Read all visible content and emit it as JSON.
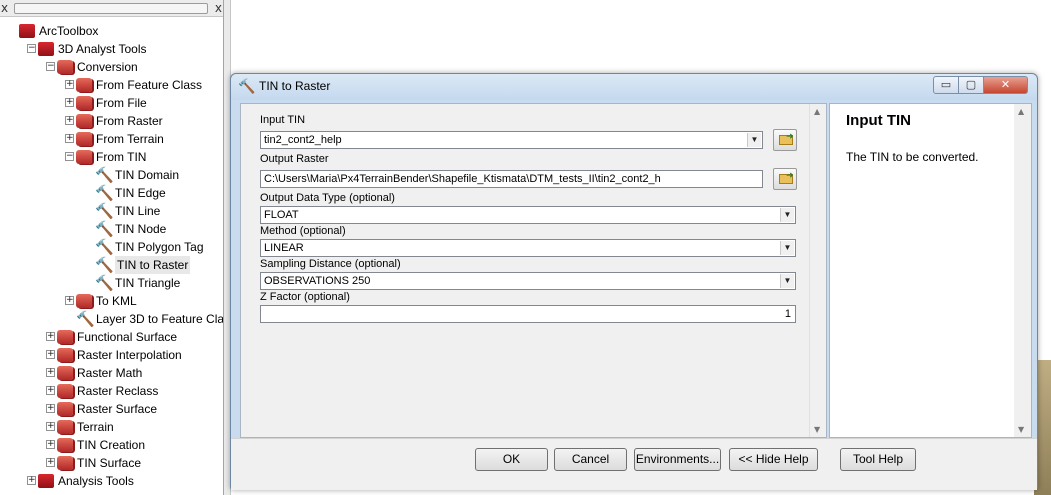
{
  "toolbox": {
    "items": [
      {
        "label": "ArcToolbox",
        "kind": "toolbox",
        "level": 0,
        "expander": ""
      },
      {
        "label": "3D Analyst Tools",
        "kind": "toolbox",
        "level": 1,
        "expander": "−"
      },
      {
        "label": "Conversion",
        "kind": "toolset",
        "level": 2,
        "expander": "−"
      },
      {
        "label": "From Feature Class",
        "kind": "toolset",
        "level": 3,
        "expander": "+"
      },
      {
        "label": "From File",
        "kind": "toolset",
        "level": 3,
        "expander": "+"
      },
      {
        "label": "From Raster",
        "kind": "toolset",
        "level": 3,
        "expander": "+"
      },
      {
        "label": "From Terrain",
        "kind": "toolset",
        "level": 3,
        "expander": "+"
      },
      {
        "label": "From TIN",
        "kind": "toolset",
        "level": 3,
        "expander": "−"
      },
      {
        "label": "TIN Domain",
        "kind": "tool",
        "level": 4,
        "expander": ""
      },
      {
        "label": "TIN Edge",
        "kind": "tool",
        "level": 4,
        "expander": ""
      },
      {
        "label": "TIN Line",
        "kind": "tool",
        "level": 4,
        "expander": ""
      },
      {
        "label": "TIN Node",
        "kind": "tool",
        "level": 4,
        "expander": ""
      },
      {
        "label": "TIN Polygon Tag",
        "kind": "tool",
        "level": 4,
        "expander": ""
      },
      {
        "label": "TIN to Raster",
        "kind": "tool",
        "level": 4,
        "expander": "",
        "selected": true
      },
      {
        "label": "TIN Triangle",
        "kind": "tool",
        "level": 4,
        "expander": ""
      },
      {
        "label": "To KML",
        "kind": "toolset",
        "level": 3,
        "expander": "+"
      },
      {
        "label": "Layer 3D to Feature Cla",
        "kind": "tool",
        "level": 3,
        "expander": ""
      },
      {
        "label": "Functional Surface",
        "kind": "toolset",
        "level": 2,
        "expander": "+"
      },
      {
        "label": "Raster Interpolation",
        "kind": "toolset",
        "level": 2,
        "expander": "+"
      },
      {
        "label": "Raster Math",
        "kind": "toolset",
        "level": 2,
        "expander": "+"
      },
      {
        "label": "Raster Reclass",
        "kind": "toolset",
        "level": 2,
        "expander": "+"
      },
      {
        "label": "Raster Surface",
        "kind": "toolset",
        "level": 2,
        "expander": "+"
      },
      {
        "label": "Terrain",
        "kind": "toolset",
        "level": 2,
        "expander": "+"
      },
      {
        "label": "TIN Creation",
        "kind": "toolset",
        "level": 2,
        "expander": "+"
      },
      {
        "label": "TIN Surface",
        "kind": "toolset",
        "level": 2,
        "expander": "+"
      },
      {
        "label": "Analysis Tools",
        "kind": "toolbox",
        "level": 1,
        "expander": "+"
      }
    ]
  },
  "dialog": {
    "title": "TIN to Raster",
    "window_buttons": {
      "minimize": "▭",
      "maximize": "▢",
      "close": "✕"
    },
    "fields": {
      "input_tin": {
        "label": "Input TIN",
        "value": "tin2_cont2_help"
      },
      "output_raster": {
        "label": "Output Raster",
        "value": "C:\\Users\\Maria\\Px4TerrainBender\\Shapefile_Ktismata\\DTM_tests_II\\tin2_cont2_h"
      },
      "output_data_type": {
        "label": "Output Data Type (optional)",
        "value": "FLOAT"
      },
      "method": {
        "label": "Method (optional)",
        "value": "LINEAR"
      },
      "sampling_distance": {
        "label": "Sampling Distance (optional)",
        "value": "OBSERVATIONS 250"
      },
      "z_factor": {
        "label": "Z Factor (optional)",
        "value": "1"
      }
    },
    "help": {
      "title": "Input TIN",
      "body": "The TIN to be converted."
    },
    "buttons": {
      "ok": "OK",
      "cancel": "Cancel",
      "environments": "Environments...",
      "hide_help": "<< Hide Help",
      "tool_help": "Tool Help"
    }
  },
  "icons": {
    "tool": "hammer-icon",
    "toolset": "toolset-icon",
    "toolbox": "toolbox-icon",
    "browse": "browse-folder-icon",
    "dropdown": "chevron-down-icon"
  }
}
